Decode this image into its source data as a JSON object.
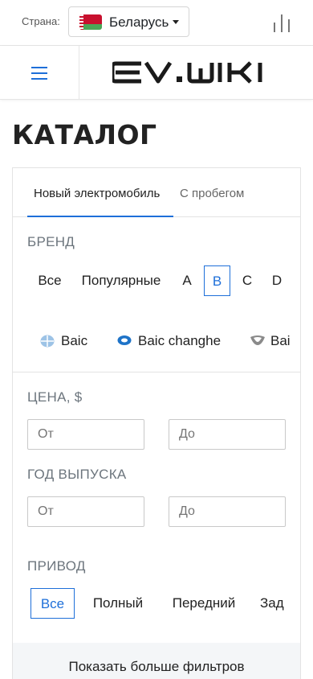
{
  "topbar": {
    "country_label": "Страна:",
    "country_name": "Беларусь",
    "flag_icon": "belarus-flag-icon"
  },
  "header": {
    "menu_icon": "hamburger-menu-icon",
    "logo_text": "EV.WIKI",
    "accent_color": "#1e6fd9"
  },
  "page_title": "КАТАЛОГ",
  "tabs": [
    {
      "label": "Новый электромобиль",
      "active": true
    },
    {
      "label": "С пробегом",
      "active": false
    }
  ],
  "brand_filter": {
    "label": "БРЕНД",
    "letters": [
      "Все",
      "Популярные",
      "A",
      "B",
      "C",
      "D"
    ],
    "active_letter": "B",
    "brands": [
      "Baic",
      "Baic changhe",
      "Bai"
    ]
  },
  "price_filter": {
    "label": "ЦЕНА, $",
    "from_placeholder": "От",
    "to_placeholder": "До"
  },
  "year_filter": {
    "label": "ГОД ВЫПУСКА",
    "from_placeholder": "От",
    "to_placeholder": "До"
  },
  "drive_filter": {
    "label": "ПРИВОД",
    "options": [
      "Все",
      "Полный",
      "Передний",
      "Зад"
    ],
    "active": "Все"
  },
  "more_filters_label": "Показать больше фильтров"
}
